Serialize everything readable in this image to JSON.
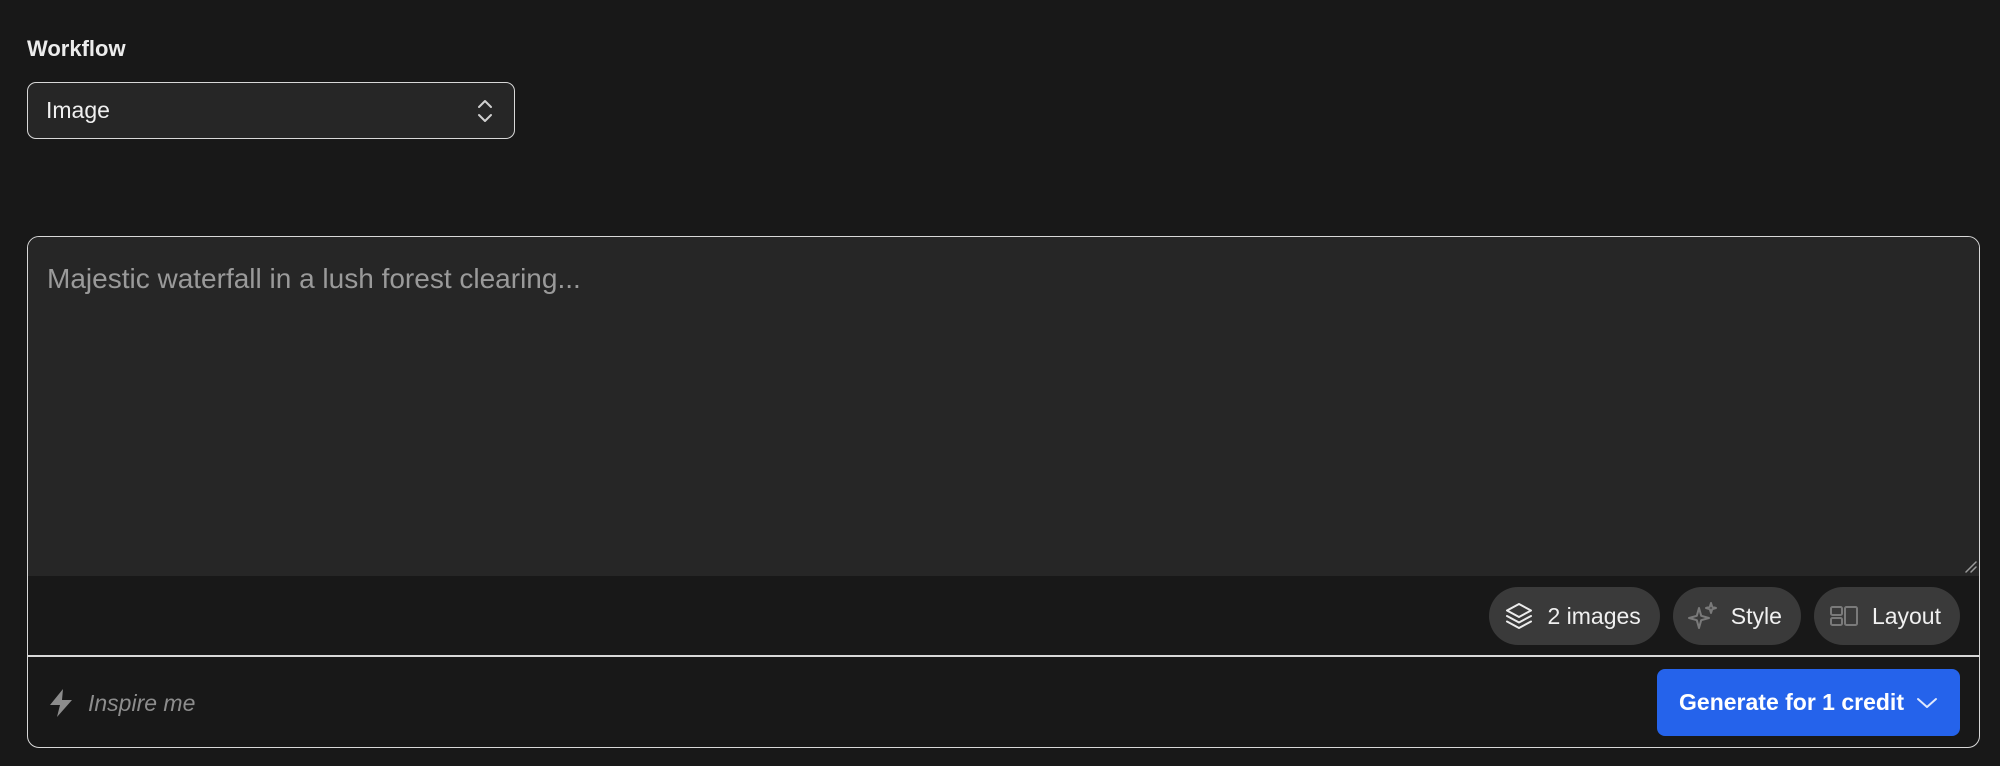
{
  "workflow": {
    "label": "Workflow",
    "selected": "Image"
  },
  "prompt": {
    "placeholder": "Majestic waterfall in a lush forest clearing..."
  },
  "chips": {
    "images": "2 images",
    "style": "Style",
    "layout": "Layout"
  },
  "inspire": {
    "label": "Inspire me"
  },
  "generate": {
    "label": "Generate for 1 credit"
  },
  "colors": {
    "background": "#181818",
    "accent": "#2563eb",
    "chip": "#3a3a3a"
  },
  "icons": {
    "select": "up-down-chevron-icon",
    "images": "layers-icon",
    "style": "sparkles-icon",
    "layout": "layout-icon",
    "inspire": "lightning-bolt-icon",
    "generate": "chevron-down-icon"
  }
}
